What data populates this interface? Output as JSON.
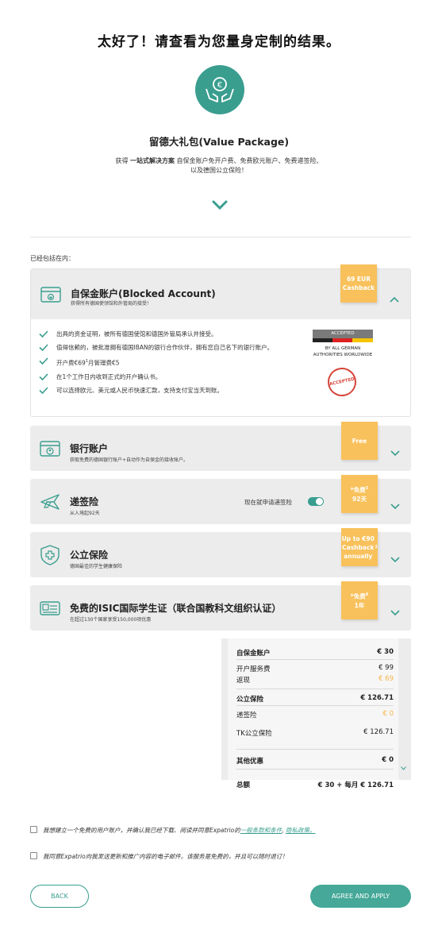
{
  "header": {
    "title": "太好了！请查看为您量身定制的结果。",
    "package_title": "留德大礼包(Value Package)",
    "desc_prefix": "获得",
    "desc_bold": "一站式解决方案",
    "desc_line1_rest": "自保金账户免开户费、免费欧元账户、免费递签险、",
    "desc_line2": "以及德国公立保险！",
    "included_label": "已经包括在内："
  },
  "cards": {
    "blocked": {
      "title": "自保金账户(Blocked Account)",
      "subtitle": "获得所有德国使领馆和外管局的接受！",
      "tag": "69 EUR Cashback",
      "bullets": [
        "出具的资金证明，被所有德国使馆和德国外管局承认并接受。",
        "值得信赖的，被批准拥有德国IBAN的银行合作伙伴，拥有您自己名下的银行账户。",
        "开户费€69",
        "在1个工作日内收到正式的开户确认书。",
        "可以选择欧元、美元或人民币快速汇款，支持支付宝当天到账。"
      ],
      "bullet3_sup": "1",
      "bullet3_rest": "月管理费€5",
      "accepted_bar": "ACCEPTED",
      "accepted_text": "BY ALL GERMAN AUTHORITIES WORLDWIDE",
      "stamp": "ACCEPTED"
    },
    "bank": {
      "title": "银行账户",
      "subtitle": "获取免费的德国银行账户+自动作为自保金的接收账户。",
      "tag": "Free"
    },
    "travel": {
      "title": "递签险",
      "subtitle": "从入境起92天",
      "tag_line1": "*免费",
      "tag_sup": "5",
      "tag_line2": "92天",
      "toggle_label": "现在就申请递签险"
    },
    "health": {
      "title": "公立保险",
      "subtitle": "德国最佳的学生健康保险",
      "tag": "Up to €90 Cashback annually",
      "tag_sup": "2"
    },
    "isic": {
      "title": "免费的ISIC国际学生证（联合国教科文组织认证）",
      "subtitle": "在超过130个国家享受150,000项优惠",
      "tag_line1": "*免费",
      "tag_sup": "6",
      "tag_line2": "1年"
    }
  },
  "summary": {
    "blocked_label": "自保金账户",
    "blocked_value": "€ 30",
    "fee_label": "开户服务费",
    "fee_value": "€ 99",
    "cashback_label": "返现",
    "cashback_value": "€ 69",
    "insurance_label": "公立保险",
    "insurance_value": "€ 126.71",
    "travel_label": "递签险",
    "travel_value": "€ 0",
    "travel_note": "",
    "tk_label": "TK公立保险",
    "tk_value": "€ 126.71",
    "tk_note": "",
    "discount_label": "其他优惠",
    "discount_value": "€ 0",
    "total_label": "总额",
    "total_value": "€ 30 + 每月 € 126.71"
  },
  "consent": {
    "c1_text": "我想建立一个免费的用户账户，并确认我已经下载、阅读并同意Expatrio的",
    "c1_link1": "一般条款和条件",
    "c1_sep": ",",
    "c1_link2": "隐私政策。",
    "c2_text": "我同意Expatrio向我发送更新和推广内容的电子邮件。该服务是免费的，并且可以随时退订！"
  },
  "buttons": {
    "back": "BACK",
    "apply": "AGREE AND APPLY"
  },
  "colors": {
    "accent": "#3a9e8f",
    "tag": "#f8c15b",
    "card_bg": "#ececec"
  }
}
